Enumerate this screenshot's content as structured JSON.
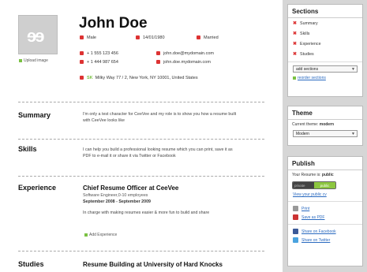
{
  "resume": {
    "upload_label": "Upload image",
    "name": "John Doe",
    "gender": "Male",
    "dob": "14/01/1980",
    "marital": "Married",
    "phone1": "+ 1 555 123 456",
    "phone2": "+ 1 444 987 654",
    "email": "john.doe@mydomain.com",
    "website": "john.doe.mydomain.com",
    "address_prefix": "SK",
    "address": "Milky Way 77 / 2, New York, NY 10001, United States",
    "summary_title": "Summary",
    "summary_text": "I'm only a test character for CeeVee and my role is to show you how a resume built with CeeVee looks like",
    "skills_title": "Skills",
    "skills_text": "I can help you build a professional looking resume which you can print, save it as PDF to e-mail it or share it via Twitter or Facebook",
    "experience_title": "Experience",
    "job_title": "Chief Resume Officer at CeeVee",
    "job_sub": "Software Engineer,0-10 employees",
    "job_date": "September 2008 - September 2009",
    "job_text": "In charge with making resumes easier & more fun to build and share",
    "add_experience": "Add Experience",
    "studies_title": "Studies",
    "study_title": "Resume Building at University of Hard Knocks"
  },
  "sections_panel": {
    "title": "Sections",
    "items": [
      "Summary",
      "Skills",
      "Experience",
      "Studies"
    ],
    "add_select": "add sections",
    "reorder_link": "reorder sections"
  },
  "theme_panel": {
    "title": "Theme",
    "current_label": "Current theme:",
    "current_value": "modern",
    "select_value": "Modern"
  },
  "publish_panel": {
    "title": "Publish",
    "status_label": "Your Resume is:",
    "status_value": "public",
    "toggle_off": "private",
    "toggle_on": "public",
    "view_link": "View your public cv",
    "print": "Print",
    "save_pdf": "Save as PDF",
    "share_fb": "Share on Facebook",
    "share_tw": "Share on Twitter"
  },
  "colors": {
    "accent_green": "#7ac143",
    "icon_red": "#dd3333",
    "link_blue": "#2a6ac0"
  }
}
